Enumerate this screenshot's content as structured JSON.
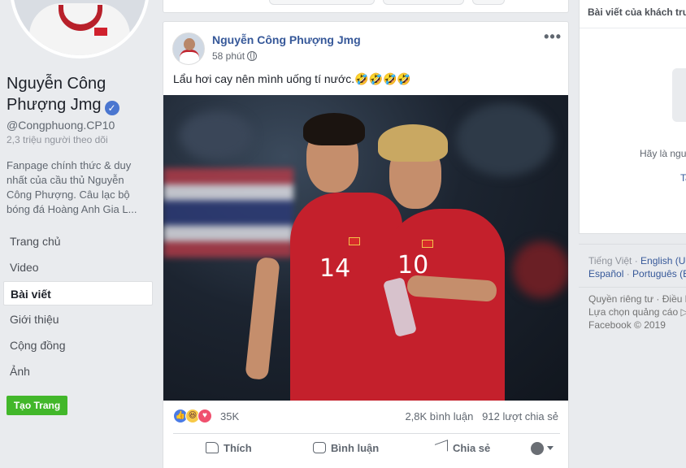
{
  "page": {
    "name": "Nguyễn Công Phượng Jmg",
    "verified_mark": "✓",
    "handle": "@Congphuong.CP10",
    "followers": "2,3 triệu người theo dõi",
    "description": "Fanpage chính thức & duy nhất của cầu thủ Nguyễn Công Phượng. Câu lạc bộ bóng đá Hoàng Anh Gia L..."
  },
  "nav": [
    {
      "label": "Trang chủ",
      "active": false
    },
    {
      "label": "Video",
      "active": false
    },
    {
      "label": "Bài viết",
      "active": true
    },
    {
      "label": "Giới thiệu",
      "active": false
    },
    {
      "label": "Cộng đồng",
      "active": false
    },
    {
      "label": "Ảnh",
      "active": false
    }
  ],
  "create_page_label": "Tạo Trang",
  "post": {
    "author": "Nguyễn Công Phượng Jmg",
    "time": "58 phút",
    "more": "•••",
    "text": "Lẩu hơi cay nên mình uống tí nước.🤣🤣🤣🤣",
    "jersey_numbers": [
      "14",
      "10"
    ],
    "reaction_icons": {
      "like": "👍",
      "haha": "😆",
      "love": "♥"
    },
    "reaction_count": "35K",
    "comments": "2,8K bình luận",
    "shares": "912 lượt chia sẻ",
    "actions": {
      "like": "Thích",
      "comment": "Bình luận",
      "share": "Chia sẻ"
    }
  },
  "right": {
    "card_title": "Bài viết của khách tru",
    "hint": "Hãy là ngư",
    "link": "Ta"
  },
  "footer": {
    "lang_current": "Tiếng Việt",
    "lang_links": [
      "English (U",
      "Español",
      "Português (E"
    ],
    "privacy": "Quyền riêng tư · Điều k",
    "ads": "Lựa chọn quảng cáo ▷",
    "copyright": "Facebook © 2019"
  },
  "colors": {
    "link": "#365899",
    "green_button": "#42b72a",
    "jersey_red": "#c4202c",
    "background": "#e9ebee"
  }
}
